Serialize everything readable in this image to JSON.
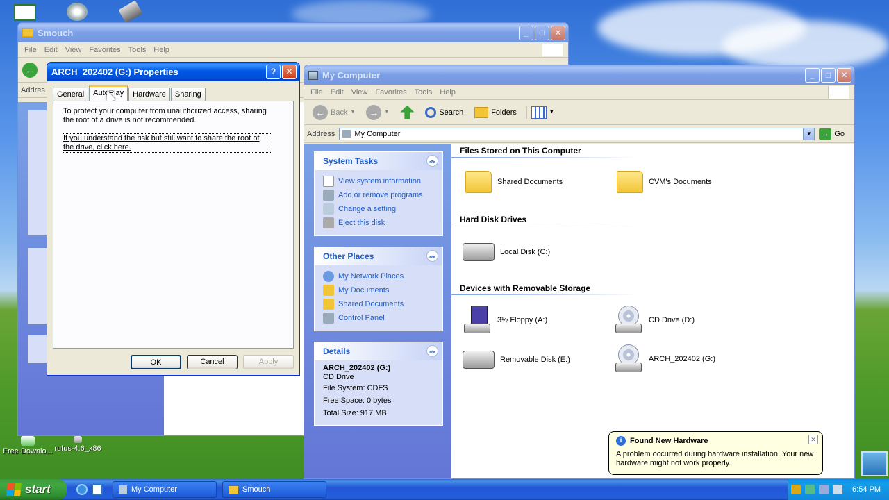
{
  "desktop": {
    "icons": [
      {
        "label": "Free Downlo..."
      },
      {
        "label": "rufus-4.6_x86"
      }
    ]
  },
  "smouch": {
    "title": "Smouch",
    "menu": [
      "File",
      "Edit",
      "View",
      "Favorites",
      "Tools",
      "Help"
    ],
    "address_label": "Addres"
  },
  "dialog": {
    "title": "ARCH_202402 (G:) Properties",
    "tabs": [
      "General",
      "AutoPlay",
      "Hardware",
      "Sharing"
    ],
    "active_tab": "AutoPlay",
    "warning": "To protect your computer from unauthorized access, sharing the root of a drive is not recommended.",
    "link": "If you understand the risk but still want to share the root of the drive, click here.",
    "buttons": {
      "ok": "OK",
      "cancel": "Cancel",
      "apply": "Apply"
    }
  },
  "mycomputer": {
    "title": "My Computer",
    "menu": [
      "File",
      "Edit",
      "View",
      "Favorites",
      "Tools",
      "Help"
    ],
    "toolbar": {
      "back": "Back",
      "search": "Search",
      "folders": "Folders"
    },
    "address": {
      "label": "Address",
      "value": "My Computer",
      "go": "Go"
    },
    "system_tasks": {
      "title": "System Tasks",
      "items": [
        "View system information",
        "Add or remove programs",
        "Change a setting",
        "Eject this disk"
      ]
    },
    "other_places": {
      "title": "Other Places",
      "items": [
        "My Network Places",
        "My Documents",
        "Shared Documents",
        "Control Panel"
      ]
    },
    "details": {
      "title": "Details",
      "name": "ARCH_202402 (G:)",
      "type": "CD Drive",
      "filesystem": "File System: CDFS",
      "free": "Free Space: 0 bytes",
      "total": "Total Size: 917 MB"
    },
    "groups": {
      "files": {
        "title": "Files Stored on This Computer",
        "items": [
          "Shared Documents",
          "CVM's Documents"
        ]
      },
      "hdd": {
        "title": "Hard Disk Drives",
        "items": [
          "Local Disk (C:)"
        ]
      },
      "removable": {
        "title": "Devices with Removable Storage",
        "items": [
          "3½ Floppy (A:)",
          "CD Drive (D:)",
          "Removable Disk (E:)",
          "ARCH_202402 (G:)"
        ]
      }
    }
  },
  "balloon": {
    "title": "Found New Hardware",
    "text": "A problem occurred during hardware installation. Your new hardware might not work properly."
  },
  "taskbar": {
    "start": "start",
    "buttons": [
      "My Computer",
      "Smouch"
    ],
    "clock": "6:54 PM"
  },
  "colors": {
    "xp_blue": "#0054e3",
    "task_link": "#215dc6",
    "start_green": "#3c9a3c"
  }
}
